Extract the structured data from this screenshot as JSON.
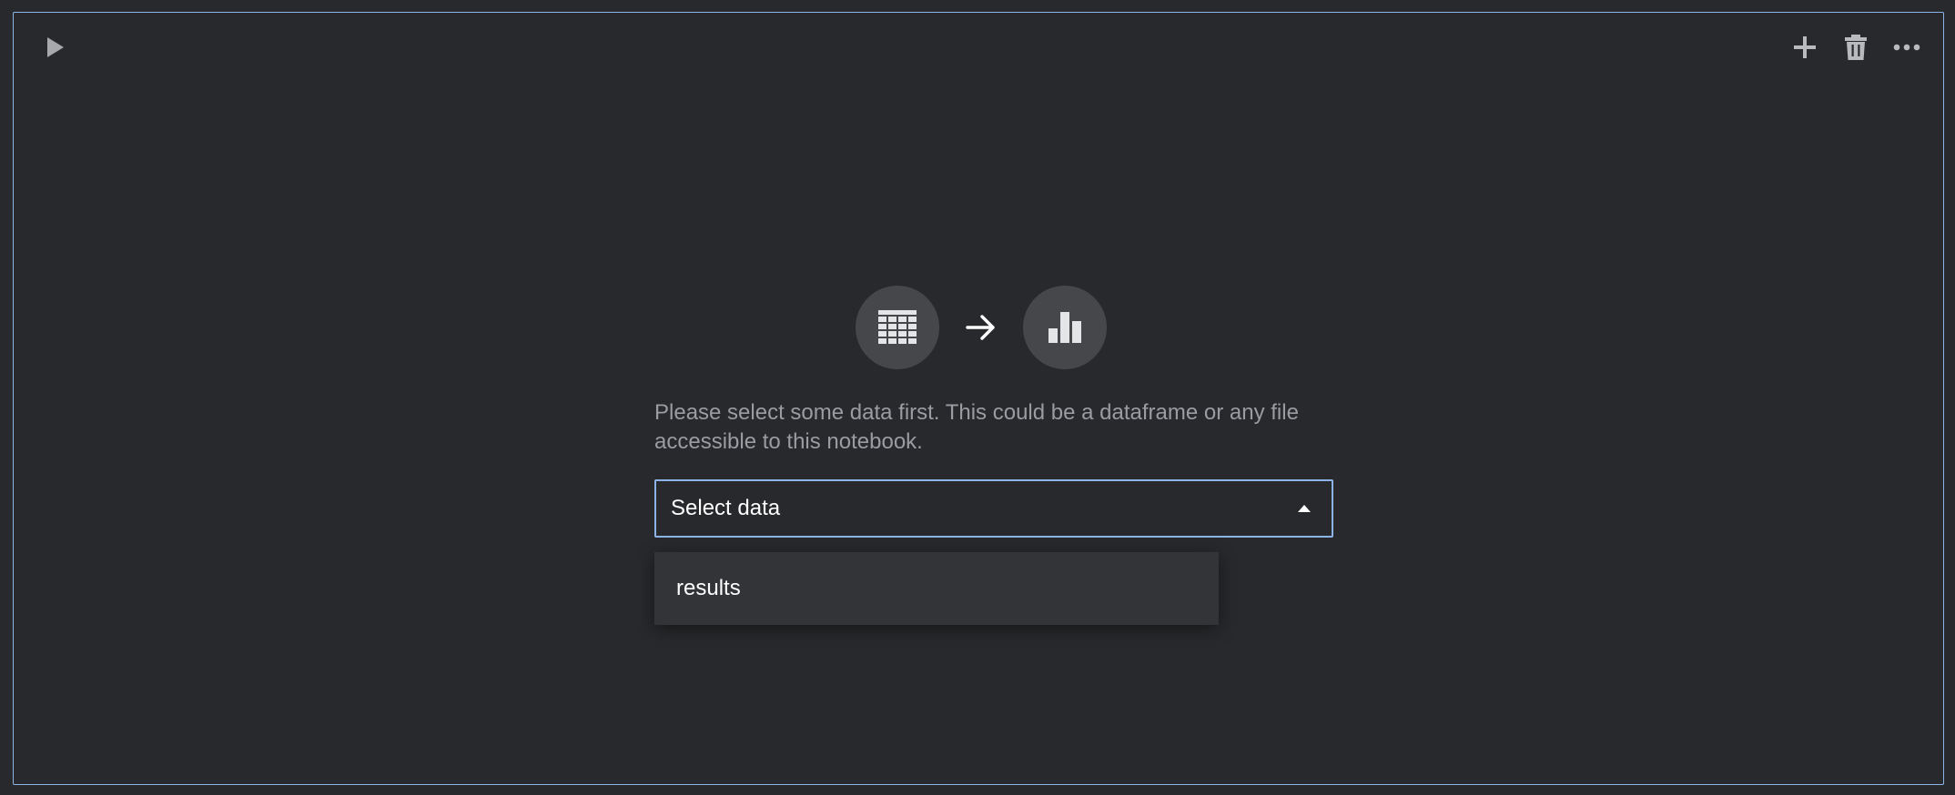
{
  "cell": {
    "run_icon": "play-icon",
    "toolbar": {
      "add_icon": "plus-icon",
      "delete_icon": "trash-icon",
      "more_icon": "more-horizontal-icon"
    }
  },
  "empty_state": {
    "source_icon": "table-icon",
    "arrow_icon": "arrow-right-icon",
    "target_icon": "bar-chart-icon",
    "message": "Please select some data first. This could be a dataframe or any file accessible to this notebook."
  },
  "data_select": {
    "value": "Select data",
    "chevron_icon": "caret-up-icon",
    "options": [
      "results"
    ]
  },
  "colors": {
    "background": "#28292c",
    "accent_border": "#8cb4e6",
    "icon_circle": "#46474b",
    "muted_text": "#9a9ca1",
    "dropdown_bg": "#333438"
  }
}
